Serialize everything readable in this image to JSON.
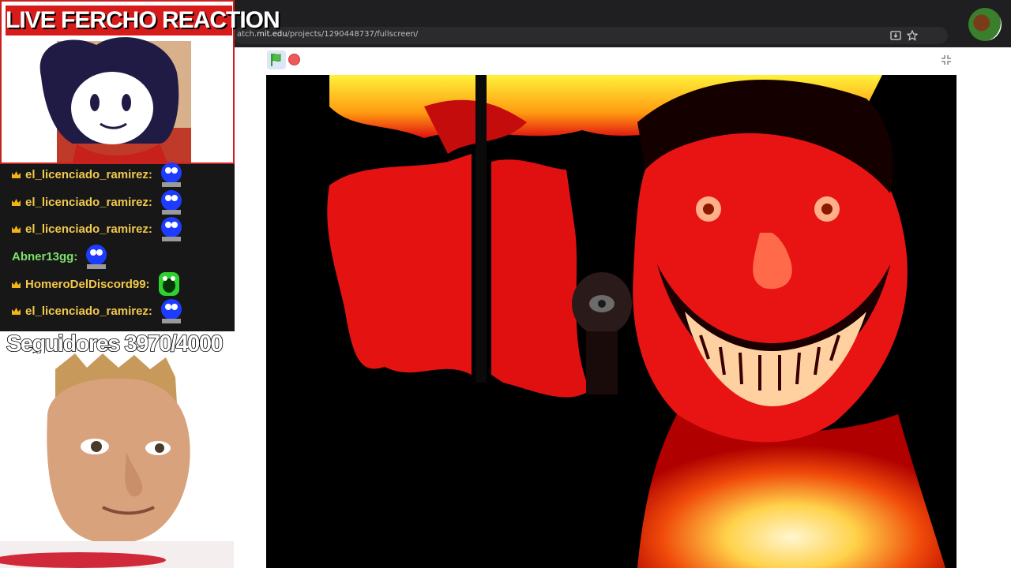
{
  "browser": {
    "url_prefix": "atch.",
    "url_domain": "mit.edu",
    "url_path": "/projects/1290448737/fullscreen/"
  },
  "overlay": {
    "banner_title": "LIVE FERCHO REACTION",
    "chat": [
      {
        "user": "el_licenciado_ramirez:",
        "color": "#f2c94c",
        "emote": "blue-ghost-emote"
      },
      {
        "user": "el_licenciado_ramirez:",
        "color": "#f2c94c",
        "emote": "blue-ghost-emote"
      },
      {
        "user": "el_licenciado_ramirez:",
        "color": "#f2c94c",
        "emote": "blue-ghost-emote"
      },
      {
        "user": "Abner13gg:",
        "color": "#7fe06a",
        "emote": "blue-ghost-emote"
      },
      {
        "user": "HomeroDelDiscord99:",
        "color": "#f2c94c",
        "emote": "green-monster-emote"
      },
      {
        "user": "el_licenciado_ramirez:",
        "color": "#f2c94c",
        "emote": "blue-ghost-emote"
      }
    ],
    "followers_text": "Seguidores 3970/4000"
  },
  "colors": {
    "chrome_bg": "#1f1f21",
    "banner_red": "#d71a1a",
    "chat_bg": "#171717",
    "stage_red": "#e01010"
  }
}
